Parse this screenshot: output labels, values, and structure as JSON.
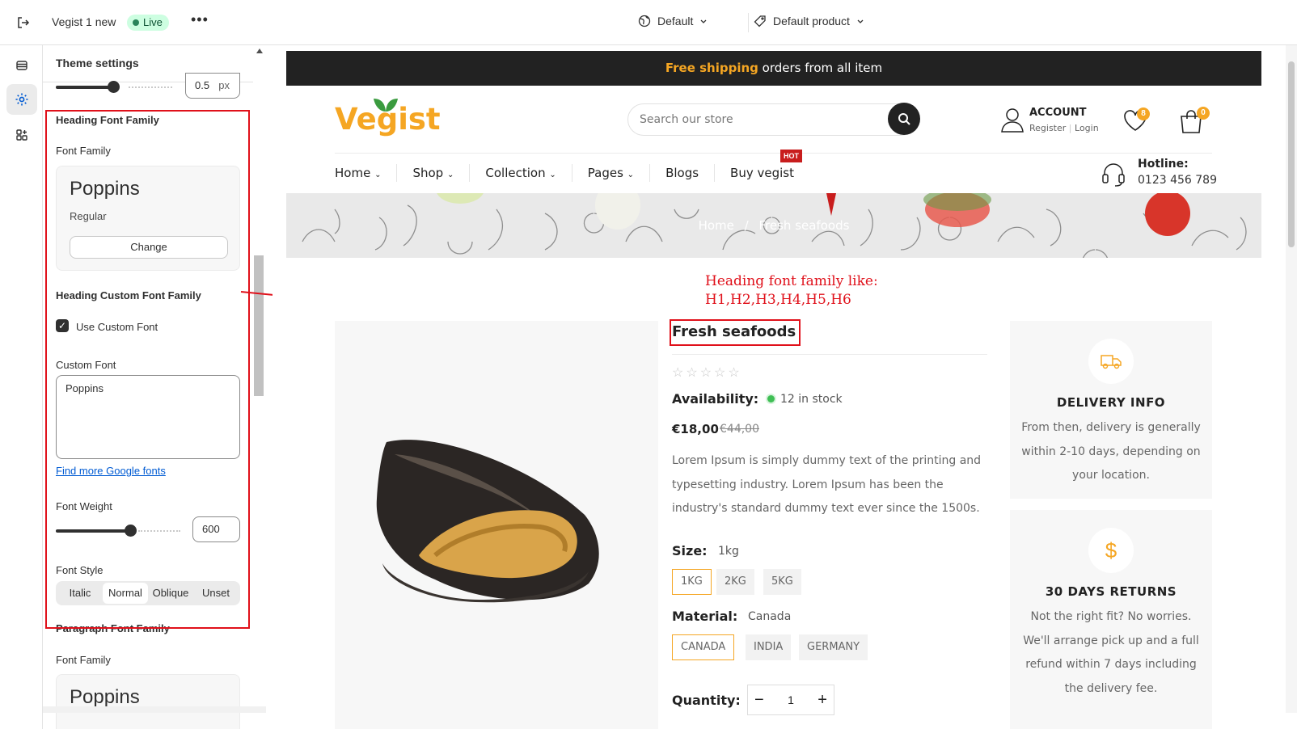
{
  "topbar": {
    "theme_name": "Vegist 1 new",
    "status_badge": "Live",
    "more_label": "•••",
    "locale_selector": "Default",
    "template_selector": "Default product"
  },
  "sidebar_rail": {
    "items": [
      {
        "icon": "sections-icon"
      },
      {
        "icon": "gear-icon",
        "active": true
      },
      {
        "icon": "apps-icon"
      }
    ]
  },
  "settings_panel": {
    "title": "Theme settings",
    "top_slider_value": "0.5",
    "top_slider_unit": "px",
    "heading_font": {
      "section_title": "Heading Font Family",
      "font_family_label": "Font Family",
      "font_name": "Poppins",
      "font_style": "Regular",
      "change_button": "Change",
      "custom_section_title": "Heading Custom Font Family",
      "use_custom_label": "Use Custom Font",
      "use_custom_checked": true,
      "custom_font_label": "Custom Font",
      "custom_font_value": "Poppins",
      "more_fonts_link": "Find more Google fonts",
      "font_weight_label": "Font Weight",
      "font_weight_value": "600",
      "font_weight_fraction": 0.6,
      "font_style_label": "Font Style",
      "font_style_options": [
        "Italic",
        "Normal",
        "Oblique",
        "Unset"
      ],
      "font_style_selected": "Normal"
    },
    "paragraph_font": {
      "section_title": "Paragraph Font Family",
      "font_family_label": "Font Family",
      "font_name": "Poppins"
    }
  },
  "preview": {
    "announcement_highlight": "Free shipping",
    "announcement_rest": " orders from all item",
    "logo": "Vegist",
    "search_placeholder": "Search our store",
    "account_title": "ACCOUNT",
    "account_register": "Register",
    "account_login": "Login",
    "wishlist_count": "8",
    "cart_count": "0",
    "nav": [
      "Home",
      "Shop",
      "Collection",
      "Pages",
      "Blogs",
      "Buy vegist"
    ],
    "nav_dropdown": [
      true,
      true,
      true,
      true,
      false,
      false
    ],
    "hot_badge": "HOT",
    "hotline_label": "Hotline:",
    "hotline_number": "0123 456 789",
    "breadcrumb_home": "Home",
    "breadcrumb_sep": "/",
    "breadcrumb_current": "Fresh seafoods",
    "annotation_line1": "Heading font family like:",
    "annotation_line2": "H1,H2,H3,H4,H5,H6",
    "product": {
      "title": "Fresh seafoods",
      "rating_stars": "☆☆☆☆☆",
      "availability_label": "Availability:",
      "stock": "12 in stock",
      "price": "€18,00",
      "compare_price": "€44,00",
      "description": "Lorem Ipsum is simply dummy text of the printing and typesetting industry. Lorem Ipsum has been the industry's standard dummy text ever since the 1500s.",
      "size_label": "Size:",
      "size_value": "1kg",
      "sizes": [
        "1KG",
        "2KG",
        "5KG"
      ],
      "material_label": "Material:",
      "material_value": "Canada",
      "materials": [
        "CANADA",
        "INDIA",
        "GERMANY"
      ],
      "quantity_label": "Quantity:",
      "quantity_value": "1",
      "qty_minus": "−",
      "qty_plus": "+"
    },
    "delivery_card": {
      "title": "DELIVERY INFO",
      "text": "From then, delivery is generally within 2-10 days, depending on your location."
    },
    "returns_card": {
      "icon_glyph": "$",
      "title": "30 DAYS RETURNS",
      "text": "Not the right fit? No worries. We'll arrange pick up and a full refund within 7 days including the delivery fee."
    }
  },
  "colors": {
    "accent": "#f5a623",
    "annotation_red": "#e0101a",
    "live_green": "#29845a"
  }
}
